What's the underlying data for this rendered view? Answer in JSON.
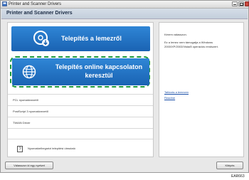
{
  "window": {
    "title": "Printer and Scanner Drivers"
  },
  "header": {
    "title": "Printer and Scanner Drivers"
  },
  "main": {
    "install_disc_label": "Telepítés a lemezről",
    "install_online_label": "Telepítés online kapcsolaton keresztül",
    "list_items": [
      "PCL nyomatóvezető",
      "PostScript 3 nyomatóvezető",
      "TWAIN Driver"
    ],
    "help_text": "Nyomatóelhegnézi telepítési útmutató"
  },
  "info_panel": {
    "title": "Kérem válasszon.",
    "description": "Ez a lemez nem támogatja a Windows 2000/XP/2003/Vista/8 operációs rendszert.",
    "link1": "Tallózás a lemezen",
    "link2": "Readme"
  },
  "footer": {
    "language_button": "Válasszon ki egy nyelvet",
    "exit_button": "Kilépés"
  },
  "image_code": "EAR663",
  "colors": {
    "button_blue": "#1f6fc4",
    "highlight_dash": "#1c9a3c",
    "header_bg": "#c9d3df"
  }
}
